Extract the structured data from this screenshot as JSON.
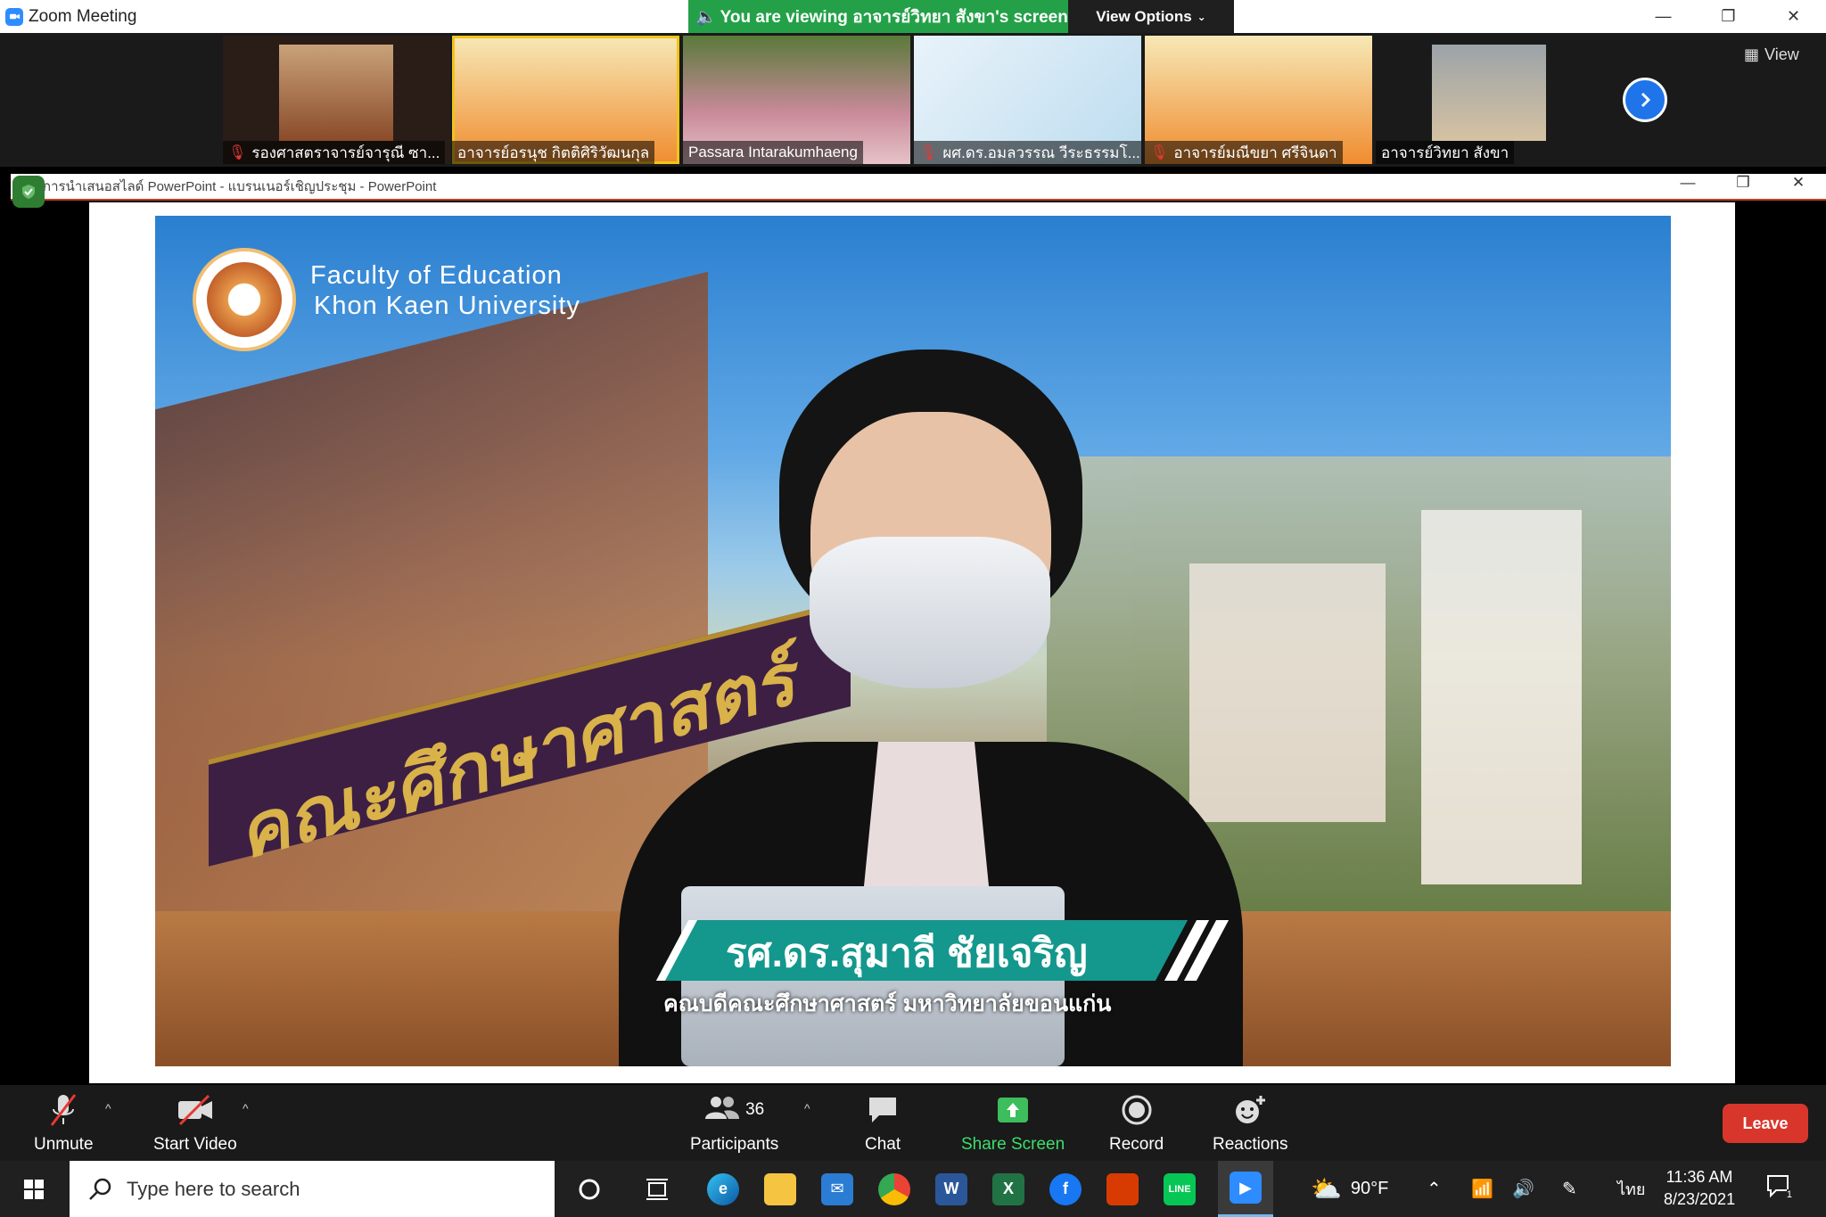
{
  "window": {
    "title": "Zoom Meeting"
  },
  "share_banner": {
    "text": "You are viewing อาจารย์วิทยา สังขา's screen",
    "view_options": "View Options"
  },
  "gallery": {
    "view_label": "View",
    "participants": [
      {
        "name": "รองศาสตราจารย์จารุณี ซา...",
        "muted": true
      },
      {
        "name": "อาจารย์อรนุช กิตติศิริวัฒนกุล",
        "muted": false,
        "active": true
      },
      {
        "name": "Passara Intarakumhaeng",
        "muted": false
      },
      {
        "name": "ผศ.ดร.อมลวรรณ วีระธรรมโ...",
        "muted": true
      },
      {
        "name": "อาจารย์มณีขยา ศรีจินดา",
        "muted": true
      },
      {
        "name": "อาจารย์วิทยา สังขา",
        "muted": false
      }
    ]
  },
  "shared_window": {
    "title": "การนำเสนอสไลด์ PowerPoint  -  แบรนเนอร์เชิญประชุม  - PowerPoint"
  },
  "slide": {
    "faculty_line1": "Faculty of Education",
    "faculty_line2": "Khon Kaen University",
    "sign_text": "คณะศึกษาศาสตร์",
    "caption_name": "รศ.ดร.สุมาลี ชัยเจริญ",
    "caption_role": "คณบดีคณะศึกษาศาสตร์  มหาวิทยาลัยขอนแก่น"
  },
  "toolbar": {
    "unmute": "Unmute",
    "start_video": "Start Video",
    "participants": "Participants",
    "participants_count": "36",
    "chat": "Chat",
    "share_screen": "Share Screen",
    "record": "Record",
    "reactions": "Reactions",
    "leave": "Leave"
  },
  "taskbar": {
    "search_placeholder": "Type here to search",
    "weather": "90°F",
    "language": "ไทย",
    "time": "11:36 AM",
    "date": "8/23/2021",
    "notifications": "1"
  },
  "colors": {
    "zoom_blue": "#2d8cff",
    "share_green": "#24a148",
    "leave_red": "#d9362b",
    "caption_teal": "#14978c"
  }
}
